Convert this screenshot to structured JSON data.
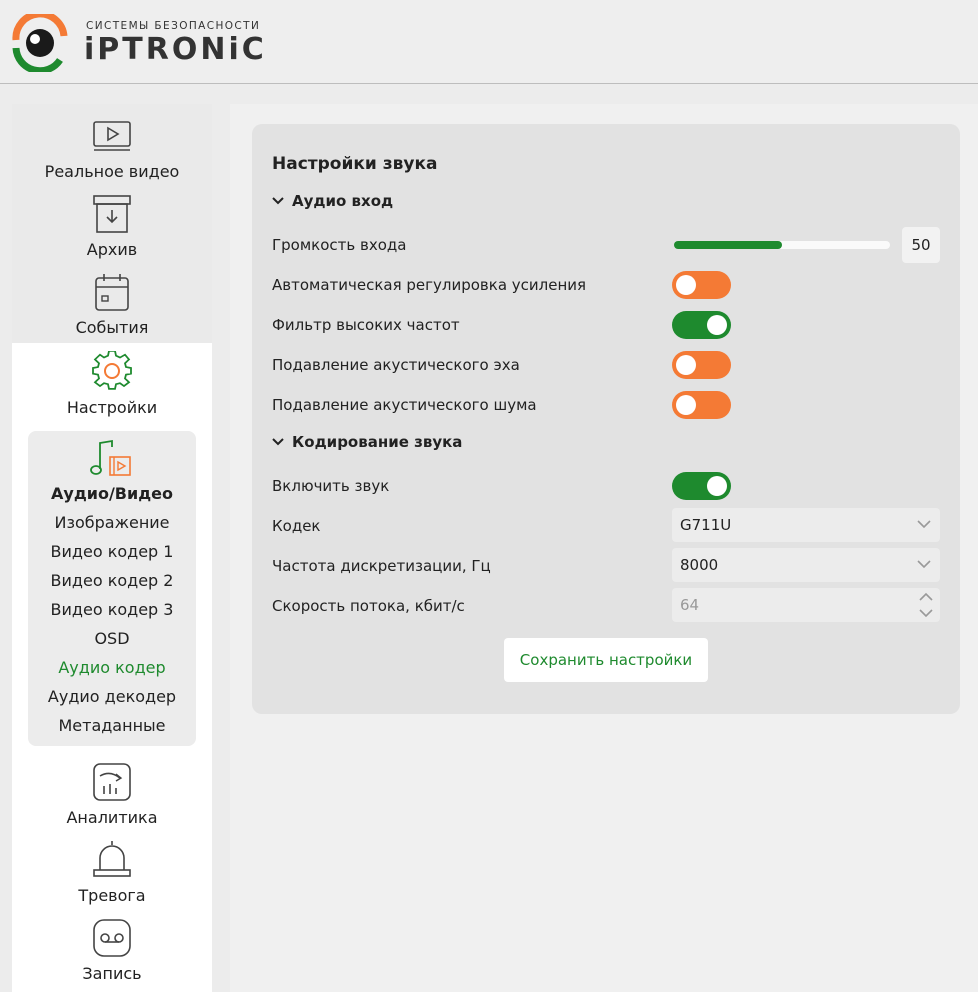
{
  "brand": {
    "subtitle": "СИСТЕМЫ БЕЗОПАСНОСТИ",
    "name": "iPTRONiC",
    "colors": {
      "orange": "#f47a35",
      "green": "#1e8a2e"
    }
  },
  "sidebar": {
    "items": [
      {
        "label": "Реальное видео",
        "icon": "play-video-icon"
      },
      {
        "label": "Архив",
        "icon": "archive-icon"
      },
      {
        "label": "События",
        "icon": "calendar-icon"
      },
      {
        "label": "Настройки",
        "icon": "gear-icon"
      },
      {
        "label": "Аналитика",
        "icon": "analytics-icon"
      },
      {
        "label": "Тревога",
        "icon": "alarm-icon"
      },
      {
        "label": "Запись",
        "icon": "record-icon"
      }
    ],
    "submenu": {
      "title": "Аудио/Видео",
      "icon": "audio-video-icon",
      "items": [
        "Изображение",
        "Видео кодер 1",
        "Видео кодер 2",
        "Видео кодер 3",
        "OSD",
        "Аудио кодер",
        "Аудио декодер",
        "Метаданные"
      ],
      "active": "Аудио кодер"
    }
  },
  "panel": {
    "title": "Настройки звука",
    "audio_input": {
      "header": "Аудио вход",
      "volume_label": "Громкость входа",
      "volume_value": "50",
      "volume_fraction": 0.5,
      "agc_label": "Автоматическая регулировка усиления",
      "agc_on": false,
      "hpf_label": "Фильтр высоких частот",
      "hpf_on": true,
      "echo_label": "Подавление акустического эха",
      "echo_on": false,
      "noise_label": "Подавление акустического шума",
      "noise_on": false
    },
    "audio_encoding": {
      "header": "Кодирование звука",
      "enable_label": "Включить звук",
      "enable_on": true,
      "codec_label": "Кодек",
      "codec_value": "G711U",
      "samplerate_label": "Частота дискретизации, Гц",
      "samplerate_value": "8000",
      "bitrate_label": "Скорость потока, кбит/с",
      "bitrate_value": "64"
    },
    "save_label": "Сохранить настройки"
  }
}
